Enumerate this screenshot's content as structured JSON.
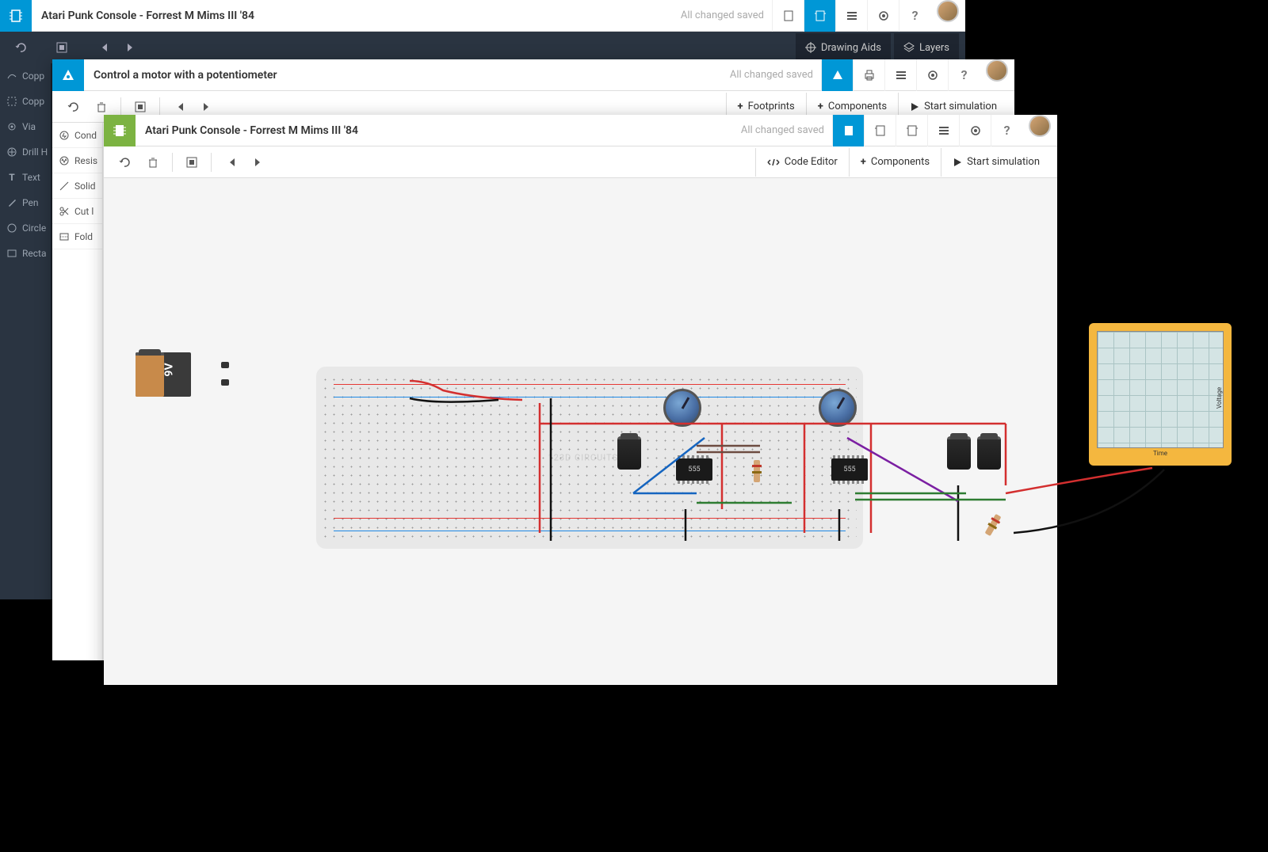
{
  "window1": {
    "title": "Atari Punk Console - Forrest M Mims III '84",
    "saved": "All changed saved",
    "help": "?",
    "toolbar": {
      "drawing_aids": "Drawing Aids",
      "layers": "Layers"
    },
    "sidebar": [
      "Copp",
      "Copp",
      "Via",
      "Drill H",
      "Text",
      "Pen",
      "Circle",
      "Recta"
    ]
  },
  "window2": {
    "title": "Control a motor with a potentiometer",
    "saved": "All changed saved",
    "help": "?",
    "toolbar": {
      "footprints": "Footprints",
      "components": "Components",
      "start_sim": "Start simulation"
    },
    "sidebar": [
      "Cond",
      "Resis",
      "Solid",
      "Cut l",
      "Fold"
    ]
  },
  "window3": {
    "title": "Atari Punk Console - Forrest M Mims III '84",
    "saved": "All changed saved",
    "help": "?",
    "toolbar": {
      "code_editor": "Code Editor",
      "components": "Components",
      "start_sim": "Start simulation"
    },
    "battery_label": "9V",
    "chip_label": "555",
    "scope_xlabel": "Time",
    "scope_ylabel": "Voltage",
    "watermark": "123D CIRCUITS.IO"
  }
}
